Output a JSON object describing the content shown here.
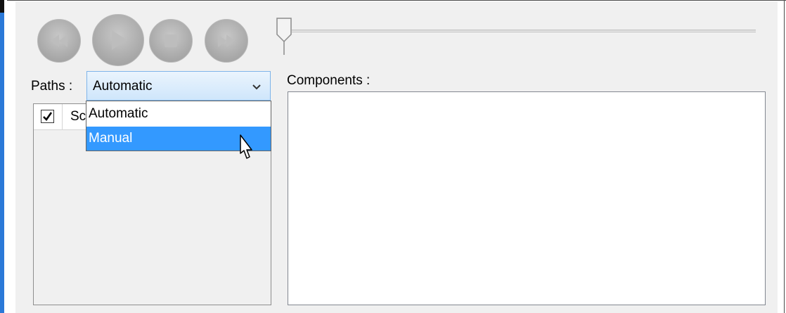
{
  "player": {
    "buttons": [
      {
        "name": "rewind-button",
        "icon": "rewind-icon"
      },
      {
        "name": "play-button",
        "icon": "play-icon"
      },
      {
        "name": "stop-button",
        "icon": "stop-icon"
      },
      {
        "name": "fast-forward-button",
        "icon": "fast-forward-icon"
      }
    ],
    "slider_position": 0
  },
  "paths": {
    "label": "Paths :",
    "selected": "Automatic",
    "options": [
      "Automatic",
      "Manual"
    ],
    "highlighted": "Manual"
  },
  "list": {
    "header_checked": true,
    "header_label": "Sc"
  },
  "components": {
    "label": "Components :"
  },
  "colors": {
    "accent": "#2b79d8",
    "highlight": "#3399ff",
    "panel": "#f0f0f0"
  }
}
